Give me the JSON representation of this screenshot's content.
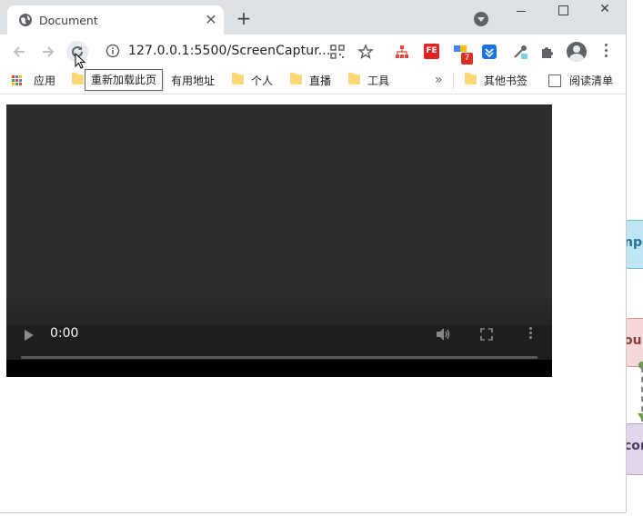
{
  "tab": {
    "title": "Document",
    "close": "✕"
  },
  "new_tab": "+",
  "window": {
    "min": "",
    "max": "",
    "close": "✕"
  },
  "address_bar": {
    "url": "127.0.0.1:5500/ScreenCaptur..."
  },
  "extensions": {
    "fe_label": "FE",
    "badge_count": "7"
  },
  "bookmarks": {
    "apps_label": "应用",
    "items": [
      "有用地址",
      "个人",
      "直播",
      "工具"
    ],
    "more": "»",
    "other_bookmarks": "其他书签",
    "reading_list": "阅读清单"
  },
  "tooltip": {
    "text": "重新加载此页"
  },
  "video": {
    "time": "0:00",
    "progress": 0
  },
  "background_window": {
    "card_texts": [
      "npo",
      "ou",
      "cor"
    ]
  },
  "colors": {
    "titlebar": "#dee1e6",
    "video_bg": "#2e2e2e",
    "folder": "#f9d877"
  }
}
